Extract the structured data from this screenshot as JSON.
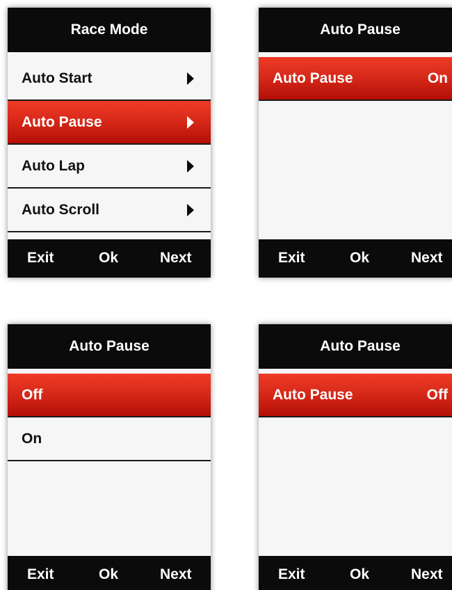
{
  "screens": [
    {
      "title": "Race Mode",
      "items": [
        {
          "label": "Auto Start"
        },
        {
          "label": "Auto Pause"
        },
        {
          "label": "Auto Lap"
        },
        {
          "label": "Auto Scroll"
        }
      ],
      "selected_index": 1,
      "buttons": {
        "exit": "Exit",
        "ok": "Ok",
        "next": "Next"
      }
    },
    {
      "title": "Auto Pause",
      "items": [
        {
          "label": "Auto Pause",
          "value": "On"
        }
      ],
      "selected_index": 0,
      "buttons": {
        "exit": "Exit",
        "ok": "Ok",
        "next": "Next"
      }
    },
    {
      "title": "Auto Pause",
      "items": [
        {
          "label": "Off"
        },
        {
          "label": "On"
        }
      ],
      "selected_index": 0,
      "buttons": {
        "exit": "Exit",
        "ok": "Ok",
        "next": "Next"
      }
    },
    {
      "title": "Auto Pause",
      "items": [
        {
          "label": "Auto Pause",
          "value": "Off"
        }
      ],
      "selected_index": 0,
      "buttons": {
        "exit": "Exit",
        "ok": "Ok",
        "next": "Next"
      }
    }
  ],
  "colors": {
    "selection_top": "#ee3a26",
    "selection_bottom": "#b30f07",
    "bar_background": "#0b0b0b",
    "screen_background": "#f6f6f6"
  },
  "icons": {
    "submenu_arrow": "chevron-right-icon"
  }
}
